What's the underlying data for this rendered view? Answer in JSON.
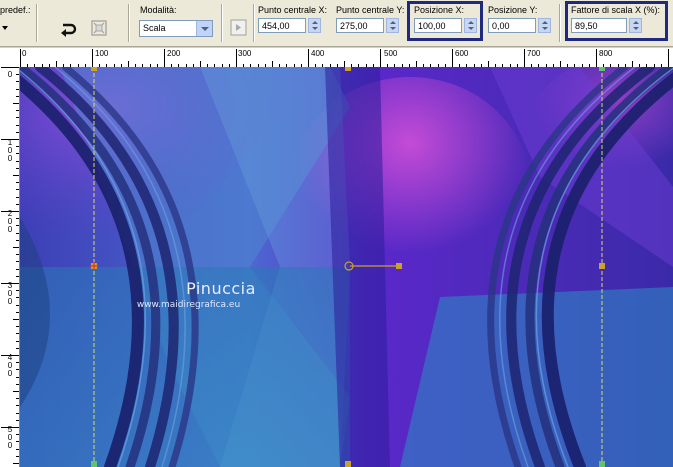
{
  "toolbar": {
    "preset_label": "predef.:",
    "mode_label": "Modalità:",
    "mode_value": "Scala",
    "center_x_label": "Punto centrale X:",
    "center_x_value": "454,00",
    "center_y_label": "Punto centrale Y:",
    "center_y_value": "275,00",
    "pos_x_label": "Posizione X:",
    "pos_x_value": "100,00",
    "pos_y_label": "Posizione Y:",
    "pos_y_value": "0,00",
    "scale_x_label": "Fattore di scala X (%):",
    "scale_x_value": "89,50"
  },
  "ruler": {
    "top_labels": [
      "0",
      "100",
      "200",
      "300",
      "400",
      "500",
      "600",
      "700",
      "800"
    ],
    "left_labels": [
      "0",
      "100",
      "200",
      "300",
      "400",
      "500"
    ]
  },
  "canvas": {
    "watermark_title": "Pinuccia",
    "watermark_url": "www.maidiregrafica.eu"
  },
  "colors": {
    "highlight_border": "#1f2a7e",
    "handle": "#c9a227",
    "guide": "#d7d86a"
  },
  "icons": [
    "dropdown-arrow-icon",
    "flip-arrow-icon",
    "reset-shape-icon",
    "place-icon",
    "spin-arrows-icon"
  ]
}
